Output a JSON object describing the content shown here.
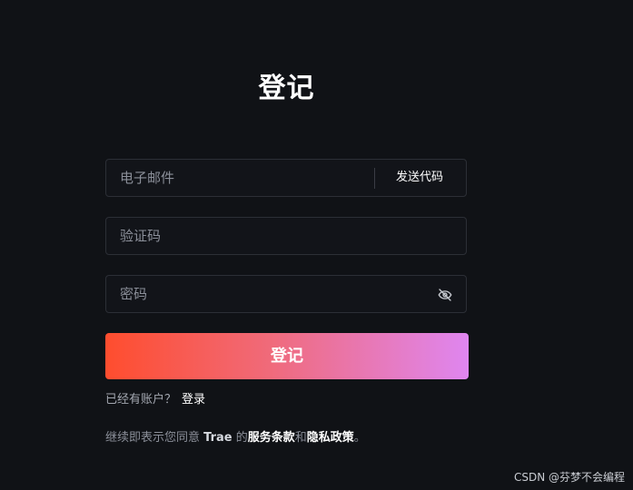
{
  "form": {
    "title": "登记",
    "email_placeholder": "电子邮件",
    "send_code_label": "发送代码",
    "code_placeholder": "验证码",
    "password_placeholder": "密码",
    "submit_label": "登记",
    "has_account_text": "已经有账户？",
    "login_link": "登录"
  },
  "terms": {
    "prefix": "继续即表示您同意 ",
    "brand": "Trae",
    "of": " 的",
    "service_link": "服务条款",
    "and": "和",
    "privacy_link": "隐私政策",
    "suffix": "。"
  },
  "watermark": "CSDN @芬梦不会编程",
  "icons": {
    "password_toggle": "eye-off-icon"
  },
  "colors": {
    "background": "#101216",
    "button_gradient_start": "#ff4d2e",
    "button_gradient_end": "#df86f0"
  }
}
